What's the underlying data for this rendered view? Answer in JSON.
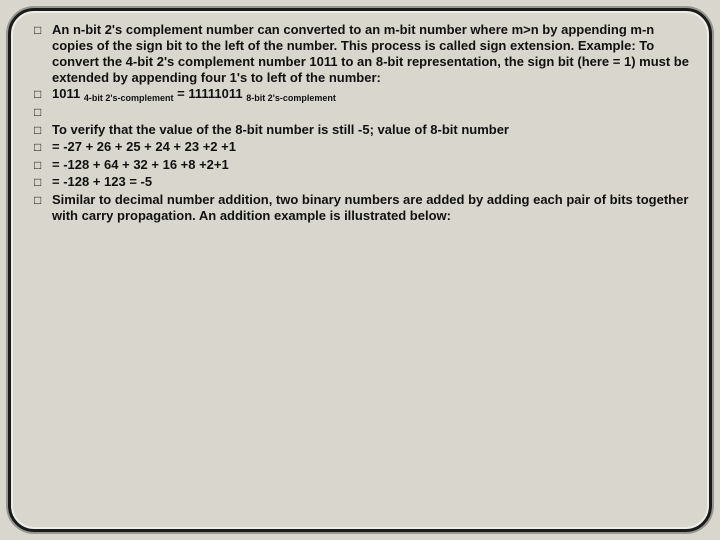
{
  "bullet_glyph": "□",
  "items": [
    {
      "text": "An n-bit 2's complement number can converted to an m-bit number where m>n by appending m-n copies of the sign bit to the left of the number. This process is called sign extension. Example: To convert the 4-bit 2's complement number 1011 to an 8-bit representation, the sign bit (here = 1) must be extended by appending four 1's to left of the number:"
    },
    {
      "pre": "1011 ",
      "sub1": "4-bit 2's-complement",
      "mid": " = 11111011 ",
      "sub2": "8-bit 2's-complement"
    },
    {
      "text": ""
    },
    {
      "text": "To verify that the value of the 8-bit number is still -5; value of 8-bit number"
    },
    {
      "text": "= -27 + 26 + 25 + 24 + 23 +2 +1"
    },
    {
      "text": "= -128 + 64 + 32 + 16 +8 +2+1"
    },
    {
      "text": "= -128 + 123 = -5"
    },
    {
      "text": "Similar to decimal number addition, two binary numbers are added by adding each pair of bits together with carry propagation. An addition example is illustrated below:"
    }
  ]
}
